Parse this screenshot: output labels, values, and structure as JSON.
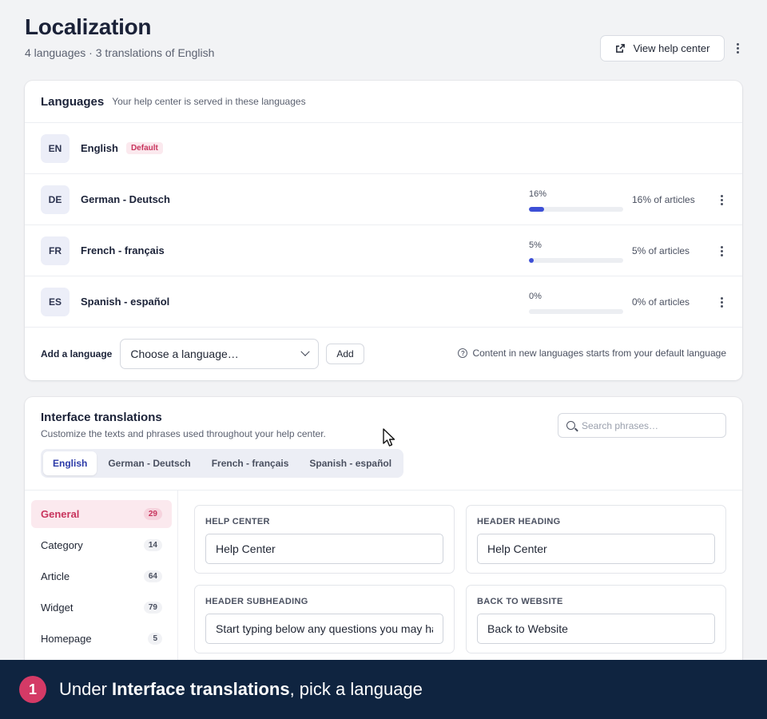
{
  "header": {
    "title": "Localization",
    "subtitle": "4 languages · 3 translations of English",
    "view_button": "View help center"
  },
  "languages_card": {
    "title": "Languages",
    "description": "Your help center is served in these languages",
    "rows": [
      {
        "code": "EN",
        "name": "English",
        "tag": "Default"
      },
      {
        "code": "DE",
        "name": "German - Deutsch",
        "percent_label": "16%",
        "progress": 16,
        "articles": "16% of articles"
      },
      {
        "code": "FR",
        "name": "French - français",
        "percent_label": "5%",
        "progress": 5,
        "articles": "5% of articles"
      },
      {
        "code": "ES",
        "name": "Spanish - español",
        "percent_label": "0%",
        "progress": 0,
        "articles": "0% of articles"
      }
    ],
    "add_label": "Add a language",
    "select_value": "Choose a language…",
    "add_button": "Add",
    "note": "Content in new languages starts from your default language"
  },
  "interface_card": {
    "title": "Interface translations",
    "description": "Customize the texts and phrases used throughout your help center.",
    "search_placeholder": "Search phrases…",
    "tabs": [
      "English",
      "German - Deutsch",
      "French - français",
      "Spanish - español"
    ],
    "categories": [
      {
        "label": "General",
        "count": "29"
      },
      {
        "label": "Category",
        "count": "14"
      },
      {
        "label": "Article",
        "count": "64"
      },
      {
        "label": "Widget",
        "count": "79"
      },
      {
        "label": "Homepage",
        "count": "5"
      }
    ],
    "fields": [
      {
        "label": "HELP CENTER",
        "value": "Help Center"
      },
      {
        "label": "HEADER HEADING",
        "value": "Help Center"
      },
      {
        "label": "HEADER SUBHEADING",
        "value": "Start typing below any questions you may have"
      },
      {
        "label": "BACK TO WEBSITE",
        "value": "Back to Website"
      }
    ]
  },
  "banner": {
    "step": "1",
    "text_before": "Under ",
    "text_bold": "Interface translations",
    "text_after": ", pick a language"
  },
  "colors": {
    "accent": "#3d4fd6",
    "brand_pink": "#c8345d",
    "banner_bg": "#0f2440"
  }
}
